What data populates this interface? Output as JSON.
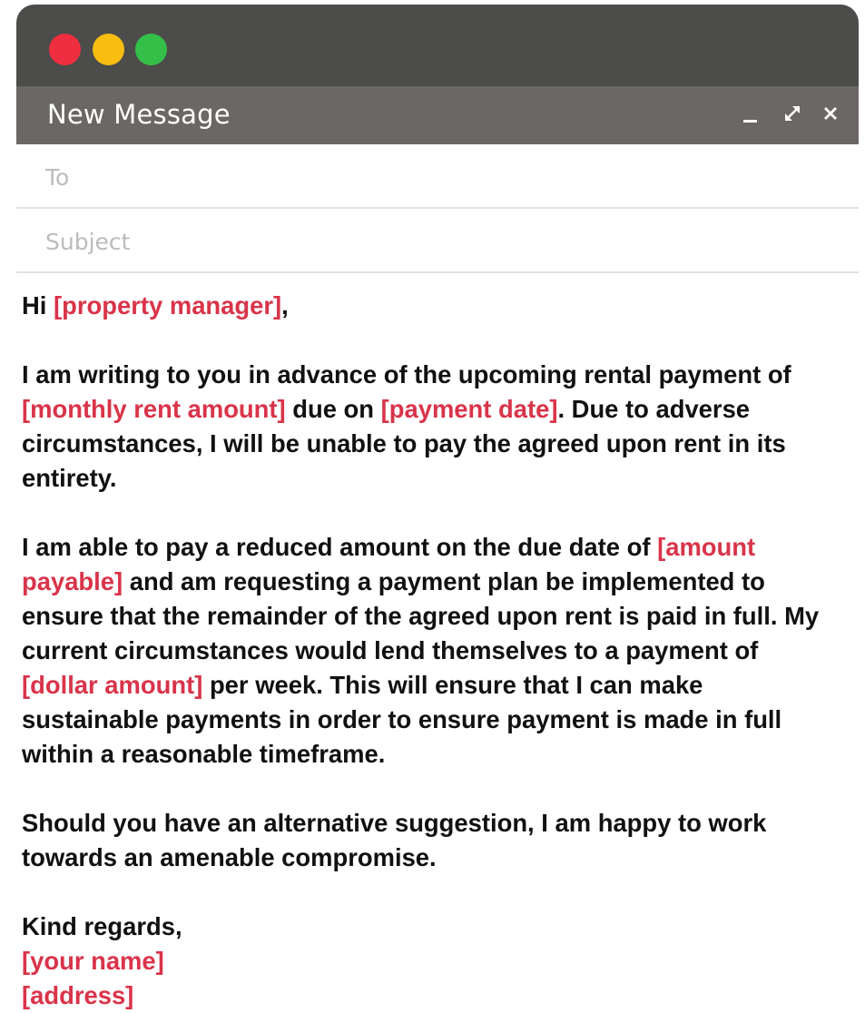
{
  "window": {
    "traffic_lights": [
      {
        "name": "close",
        "color": "#ef2f3f"
      },
      {
        "name": "minimize",
        "color": "#f7bd10"
      },
      {
        "name": "zoom",
        "color": "#34bf49"
      }
    ],
    "title": "New Message",
    "controls": {
      "minimize_glyph": "_",
      "expand_glyph": "⤢",
      "close_glyph": "×"
    }
  },
  "fields": {
    "to_placeholder": "To",
    "subject_placeholder": "Subject"
  },
  "email": {
    "greeting": {
      "pre": "Hi ",
      "ph": "[property manager]",
      "post": ","
    },
    "para1": {
      "t1": "I am writing to you in advance of the upcoming rental payment of ",
      "ph1": "[monthly rent amount]",
      "t2": " due on ",
      "ph2": "[payment date]",
      "t3": ". Due to adverse circumstances, I will be unable to pay the agreed upon rent in its entirety."
    },
    "para2": {
      "t1": "I am able to pay a reduced amount on the due date of ",
      "ph1": "[amount payable]",
      "t2": " and am requesting a payment plan be implemented to ensure that the remainder of the agreed upon rent is paid in full. My current circumstances would lend themselves to a payment of ",
      "ph2": "[dollar amount]",
      "t3": " per week. This will ensure that I can make sustainable payments in order to ensure payment is made in full within a reasonable timeframe."
    },
    "para3": "Should you have an alternative suggestion, I am happy to work towards an amenable compromise.",
    "signoff": "Kind regards,",
    "name_ph": "[your name]",
    "address_ph": "[address]"
  },
  "colors": {
    "titlebar": "#4c4c4a",
    "msgbar": "#6b6764",
    "placeholder_text": "#d9344a"
  }
}
